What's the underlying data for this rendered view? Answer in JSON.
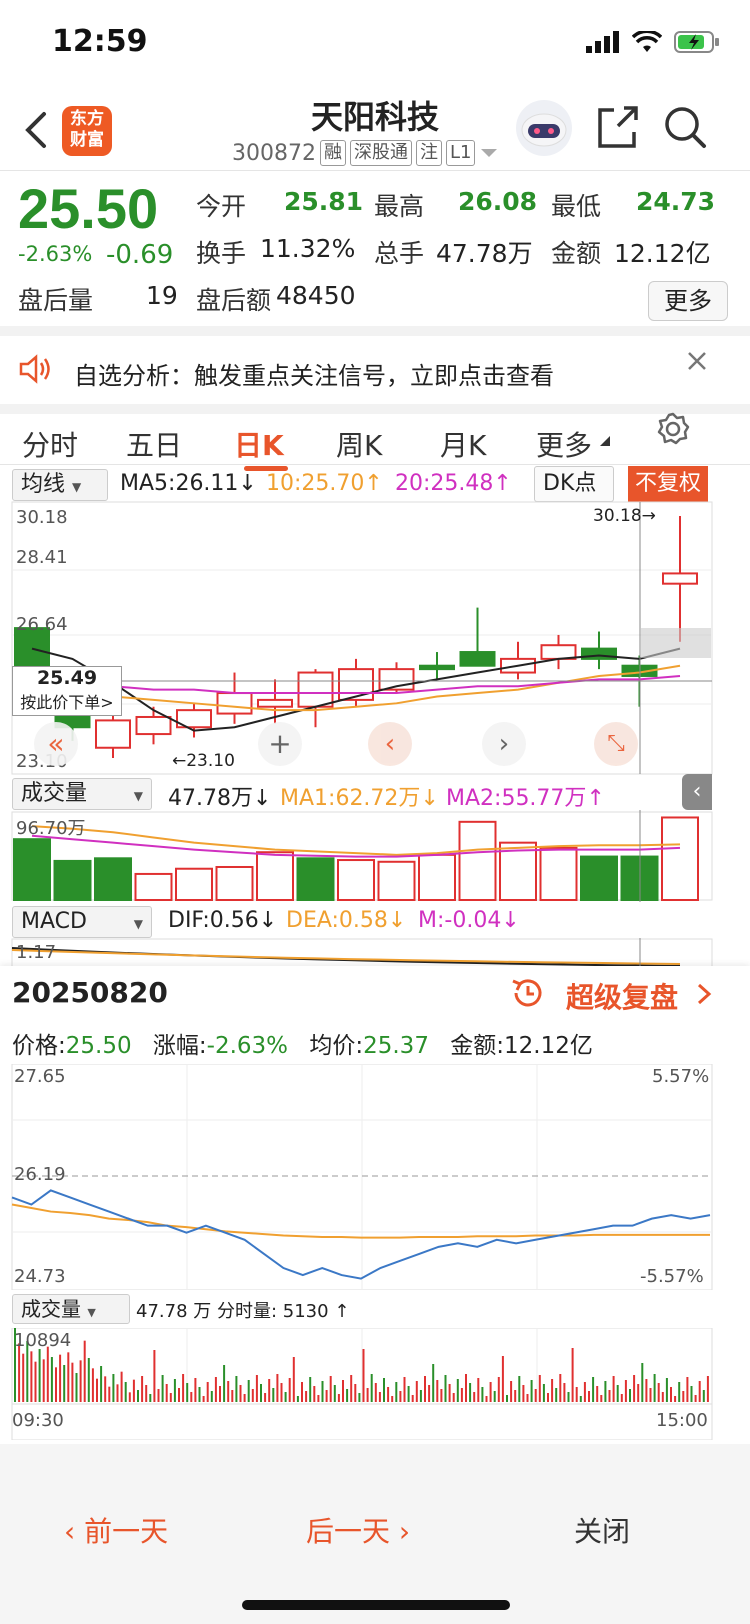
{
  "status": {
    "time": "12:59"
  },
  "header": {
    "title": "天阳科技",
    "code": "300872",
    "tags": [
      "融",
      "深股通",
      "注",
      "L1"
    ],
    "logo_line1": "东方",
    "logo_line2": "财富"
  },
  "quote": {
    "price": "25.50",
    "change_pct": "-2.63%",
    "change": "-0.69",
    "after_vol_label": "盘后量",
    "after_vol": "19",
    "open_label": "今开",
    "open": "25.81",
    "high_label": "最高",
    "high": "26.08",
    "low_label": "最低",
    "low": "24.73",
    "turnover_label": "换手",
    "turnover": "11.32%",
    "volume_label": "总手",
    "volume": "47.78万",
    "amount_label": "金额",
    "amount": "12.12亿",
    "after_amount_label": "盘后额",
    "after_amount": "48450",
    "more_label": "更多"
  },
  "banner": {
    "text": "自选分析：触发重点关注信号，立即点击查看"
  },
  "tabs": [
    "分时",
    "五日",
    "日K",
    "周K",
    "月K",
    "更多"
  ],
  "active_tab": 2,
  "kline": {
    "ma_select": "均线",
    "ma5": "MA5:26.11",
    "ma10": "10:25.70",
    "ma20": "20:25.48",
    "dk_label": "DK点",
    "adjust_label": "不复权",
    "y_labels": [
      "30.18",
      "28.41",
      "26.64",
      "23.10"
    ],
    "max_marker": "30.18→",
    "min_marker": "←23.10",
    "cursor_price": "25.49",
    "cursor_hint": "按此价下单>",
    "chart_data": {
      "type": "candlestick",
      "ylim": [
        23.1,
        30.18
      ],
      "candles": [
        {
          "o": 26.9,
          "c": 25.8,
          "h": 26.9,
          "l": 25.5
        },
        {
          "o": 24.8,
          "c": 24.0,
          "h": 24.8,
          "l": 23.6
        },
        {
          "o": 23.4,
          "c": 24.2,
          "h": 24.4,
          "l": 23.1
        },
        {
          "o": 23.8,
          "c": 24.3,
          "h": 24.6,
          "l": 23.5
        },
        {
          "o": 24.0,
          "c": 24.5,
          "h": 24.7,
          "l": 23.7
        },
        {
          "o": 24.4,
          "c": 25.0,
          "h": 25.6,
          "l": 24.1
        },
        {
          "o": 24.6,
          "c": 24.8,
          "h": 25.4,
          "l": 24.1
        },
        {
          "o": 24.6,
          "c": 25.6,
          "h": 25.7,
          "l": 24.0
        },
        {
          "o": 24.8,
          "c": 25.7,
          "h": 26.0,
          "l": 24.6
        },
        {
          "o": 25.1,
          "c": 25.7,
          "h": 25.9,
          "l": 25.0
        },
        {
          "o": 25.8,
          "c": 25.7,
          "h": 26.2,
          "l": 25.4
        },
        {
          "o": 26.2,
          "c": 25.8,
          "h": 27.5,
          "l": 25.8
        },
        {
          "o": 25.6,
          "c": 26.0,
          "h": 26.5,
          "l": 25.4
        },
        {
          "o": 26.0,
          "c": 26.4,
          "h": 26.7,
          "l": 25.7
        },
        {
          "o": 26.3,
          "c": 26.0,
          "h": 26.8,
          "l": 25.7
        },
        {
          "o": 25.8,
          "c": 25.5,
          "h": 26.1,
          "l": 24.6
        },
        {
          "o": 28.2,
          "c": 28.5,
          "h": 30.18,
          "l": 26.5
        }
      ],
      "ma5": [
        26.3,
        26.0,
        25.3,
        24.5,
        23.9,
        24.0,
        24.3,
        24.6,
        24.9,
        25.2,
        25.4,
        25.6,
        25.8,
        26.0,
        26.1,
        26.0,
        26.3
      ],
      "ma10": [
        25.0,
        25.0,
        24.9,
        24.8,
        24.7,
        24.6,
        24.5,
        24.5,
        24.6,
        24.7,
        24.9,
        25.0,
        25.1,
        25.3,
        25.5,
        25.6,
        25.8
      ],
      "ma20": [
        25.2,
        25.2,
        25.2,
        25.1,
        25.1,
        25.0,
        25.0,
        25.0,
        25.0,
        25.0,
        25.1,
        25.2,
        25.2,
        25.3,
        25.4,
        25.4,
        25.5
      ]
    }
  },
  "volume": {
    "select": "成交量",
    "value": "47.78万",
    "ma1": "MA1:62.72万",
    "ma2": "MA2:55.77万",
    "y_max": "96.70万",
    "chart_data": {
      "type": "bar",
      "ylim": [
        0,
        96.7
      ],
      "values": [
        70,
        45,
        48,
        30,
        36,
        38,
        55,
        48,
        46,
        44,
        52,
        90,
        66,
        60,
        50,
        50,
        95
      ],
      "colors": [
        "g",
        "g",
        "g",
        "r",
        "r",
        "r",
        "r",
        "g",
        "r",
        "r",
        "r",
        "r",
        "r",
        "r",
        "g",
        "g",
        "r"
      ],
      "ma1": [
        85,
        82,
        78,
        72,
        66,
        62,
        58,
        56,
        54,
        52,
        54,
        58,
        60,
        62,
        63,
        63,
        64
      ],
      "ma2": [
        74,
        70,
        66,
        62,
        58,
        55,
        52,
        51,
        50,
        50,
        52,
        55,
        57,
        58,
        58,
        58,
        60
      ]
    }
  },
  "macd": {
    "select": "MACD",
    "dif": "DIF:0.56",
    "dea": "DEA:0.58",
    "m": "M:-0.04",
    "y_max": "1.17"
  },
  "detail": {
    "date": "20250820",
    "replay_label": "超级复盘",
    "price_label": "价格:",
    "price": "25.50",
    "change_label": "涨幅:",
    "change": "-2.63%",
    "avg_label": "均价:",
    "avg": "25.37",
    "amount_label": "金额:",
    "amount": "12.12亿",
    "y_top": "27.65",
    "y_mid": "26.19",
    "y_bot": "24.73",
    "pct_top": "5.57%",
    "pct_bot": "-5.57%",
    "vol_select": "成交量",
    "vol_info": "47.78 万  分时量: 5130",
    "vol_max": "10894",
    "t_start": "09:30",
    "t_end": "15:00",
    "chart_data": {
      "type": "line",
      "ylim": [
        24.73,
        27.65
      ],
      "price": [
        25.9,
        25.8,
        26.0,
        25.9,
        25.8,
        25.7,
        25.6,
        25.5,
        25.5,
        25.4,
        25.5,
        25.4,
        25.3,
        25.1,
        24.9,
        24.8,
        24.9,
        24.8,
        24.75,
        24.9,
        25.0,
        25.1,
        25.2,
        25.25,
        25.2,
        25.3,
        25.25,
        25.3,
        25.35,
        25.4,
        25.45,
        25.5,
        25.5,
        25.6,
        25.65,
        25.6,
        25.65
      ],
      "avg": [
        25.8,
        25.75,
        25.7,
        25.68,
        25.65,
        25.6,
        25.58,
        25.55,
        25.5,
        25.48,
        25.45,
        25.42,
        25.4,
        25.38,
        25.36,
        25.35,
        25.34,
        25.34,
        25.33,
        25.33,
        25.33,
        25.34,
        25.34,
        25.34,
        25.35,
        25.35,
        25.35,
        25.36,
        25.36,
        25.36,
        25.37,
        25.37,
        25.37,
        25.37,
        25.37,
        25.37,
        25.37
      ]
    }
  },
  "bottom": {
    "prev": "前一天",
    "next": "后一天",
    "close": "关闭"
  }
}
